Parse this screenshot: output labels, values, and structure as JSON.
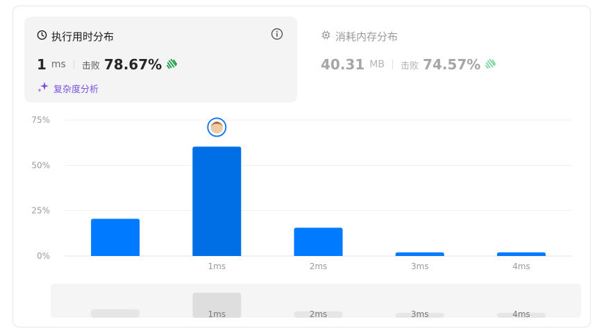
{
  "runtime": {
    "title": "执行用时分布",
    "value": "1",
    "unit": "ms",
    "beats_label": "击败",
    "beats_value": "78.67%",
    "complexity_link": "复杂度分析",
    "icons": {
      "title": "clock-icon",
      "info": "info-icon",
      "beats": "clap-icon",
      "complexity": "sparkle-icon"
    }
  },
  "memory": {
    "title": "消耗内存分布",
    "value": "40.31",
    "unit": "MB",
    "beats_label": "击败",
    "beats_value": "74.57%",
    "icons": {
      "title": "chip-icon",
      "beats": "clap-icon"
    }
  },
  "colors": {
    "bar": "#007aff",
    "bar_selected": "#006fe6",
    "memory_clap": "#7fd7a4",
    "runtime_clap": "#1f9e4a",
    "accent": "#7b4fe0"
  },
  "chart_data": {
    "type": "bar",
    "categories": [
      "",
      "1ms",
      "2ms",
      "3ms",
      "4ms"
    ],
    "values": [
      20.5,
      60.3,
      15.6,
      2.0,
      2.0
    ],
    "selected_index": 1,
    "yticks": [
      "0%",
      "25%",
      "50%",
      "75%"
    ],
    "ytick_values": [
      0,
      25,
      50,
      75
    ],
    "ylim": [
      0,
      75
    ],
    "grid": true,
    "overview_labels": [
      "1ms",
      "2ms",
      "3ms",
      "4ms"
    ]
  }
}
